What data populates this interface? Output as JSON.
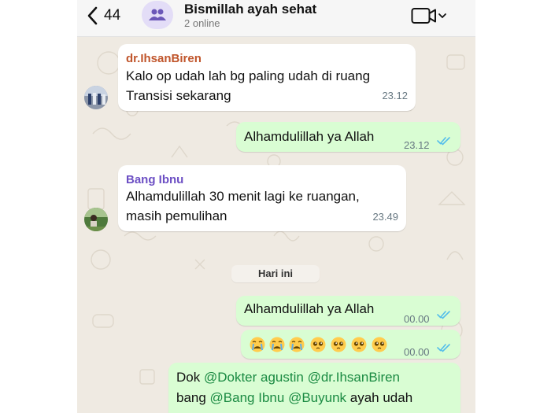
{
  "header": {
    "back_count": "44",
    "group_title": "Bismillah ayah sehat",
    "subtitle": "2 online"
  },
  "messages": [
    {
      "direction": "incoming",
      "sender": "dr.IhsanBiren",
      "sender_color": "#c0552b",
      "lines": [
        "Kalo op udah lah bg paling udah di ruang",
        "Transisi sekarang"
      ],
      "time": "23.12"
    },
    {
      "direction": "outgoing",
      "text": "Alhamdulillah ya Allah",
      "time": "23.12",
      "status": "read"
    },
    {
      "direction": "incoming",
      "sender": "Bang Ibnu",
      "sender_color": "#6c4fc4",
      "lines": [
        "Alhamdulillah 30 menit lagi ke ruangan,",
        "masih pemulihan"
      ],
      "time": "23.49"
    },
    {
      "direction": "outgoing",
      "text": "Alhamdulillah ya Allah",
      "time": "00.00",
      "status": "read"
    },
    {
      "direction": "outgoing",
      "emojis": [
        "crying-face",
        "crying-face",
        "crying-face",
        "pleading-face",
        "pleading-face",
        "pleading-face",
        "pleading-face"
      ],
      "time": "00.00",
      "status": "read"
    },
    {
      "direction": "outgoing",
      "line1": {
        "prefix": "Dok ",
        "mention1": "@Dokter agustin",
        "sep": " ",
        "mention2": "@dr.IhsanBiren"
      },
      "line2": {
        "prefix": "bang ",
        "mention1": "@Bang Ibnu",
        "sep": " ",
        "mention2": "@Buyunk",
        "suffix": " ayah udah"
      },
      "mention_color": "#1a8a42"
    }
  ],
  "date_separator": "Hari ini",
  "colors": {
    "chat_bg": "#efeae2",
    "outgoing_bubble": "#d9fdd3",
    "incoming_bubble": "#ffffff",
    "read_tick": "#53bdeb"
  },
  "icons": {
    "back": "chevron-left-icon",
    "group": "group-icon",
    "video": "video-camera-icon",
    "read_receipt": "double-check-icon"
  }
}
